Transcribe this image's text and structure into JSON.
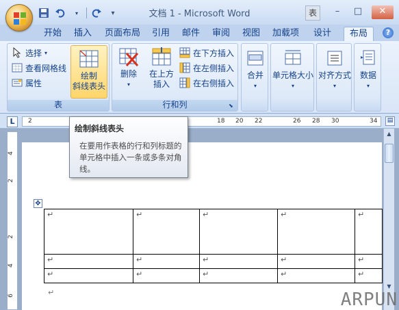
{
  "window": {
    "title": "文档 1 - Microsoft Word",
    "context_tab_label": "表",
    "minimize": "–",
    "maximize": "□",
    "close": "✕"
  },
  "qat": {
    "more": "▾"
  },
  "tabs": [
    {
      "label": "开始"
    },
    {
      "label": "插入"
    },
    {
      "label": "页面布局"
    },
    {
      "label": "引用"
    },
    {
      "label": "邮件"
    },
    {
      "label": "审阅"
    },
    {
      "label": "视图"
    },
    {
      "label": "加载项"
    },
    {
      "label": "设计"
    },
    {
      "label": "布局"
    }
  ],
  "active_tab": "布局",
  "help": "?",
  "ribbon": {
    "table_group": {
      "label": "表",
      "select": "选择",
      "view_gridlines": "查看网格线",
      "properties": "属性",
      "draw_diagonal_line1": "绘制",
      "draw_diagonal_line2": "斜线表头"
    },
    "rows_cols_group": {
      "label": "行和列",
      "delete": "删除",
      "insert_above_line1": "在上方",
      "insert_above_line2": "插入",
      "insert_below": "在下方插入",
      "insert_left": "在左侧插入",
      "insert_right": "在右侧插入"
    },
    "merge": "合并",
    "cell_size": "单元格大小",
    "alignment": "对齐方式",
    "data": "数据"
  },
  "ruler": {
    "ticks": [
      "2",
      "18",
      "20",
      "22",
      "26",
      "28",
      "30",
      "34"
    ],
    "vticks": [
      "4",
      "2",
      "2",
      "4",
      "6"
    ]
  },
  "tooltip": {
    "title": "绘制斜线表头",
    "body": "在要用作表格的行和列标题的单元格中插入一条或多条对角线。"
  },
  "table": {
    "paragraph_mark": "↵",
    "rows": [
      [
        "↵",
        "↵",
        "↵",
        "↵",
        "↵"
      ],
      [
        "↵",
        "↵",
        "↵",
        "↵",
        "↵"
      ],
      [
        "↵",
        "↵",
        "↵",
        "↵",
        "↵"
      ]
    ]
  },
  "after_table_mark": "↵",
  "watermark": "ARPUN",
  "colors": {
    "ribbon_text": "#15428b",
    "highlight": "#ffd56b",
    "close_button": "#d4603f"
  }
}
